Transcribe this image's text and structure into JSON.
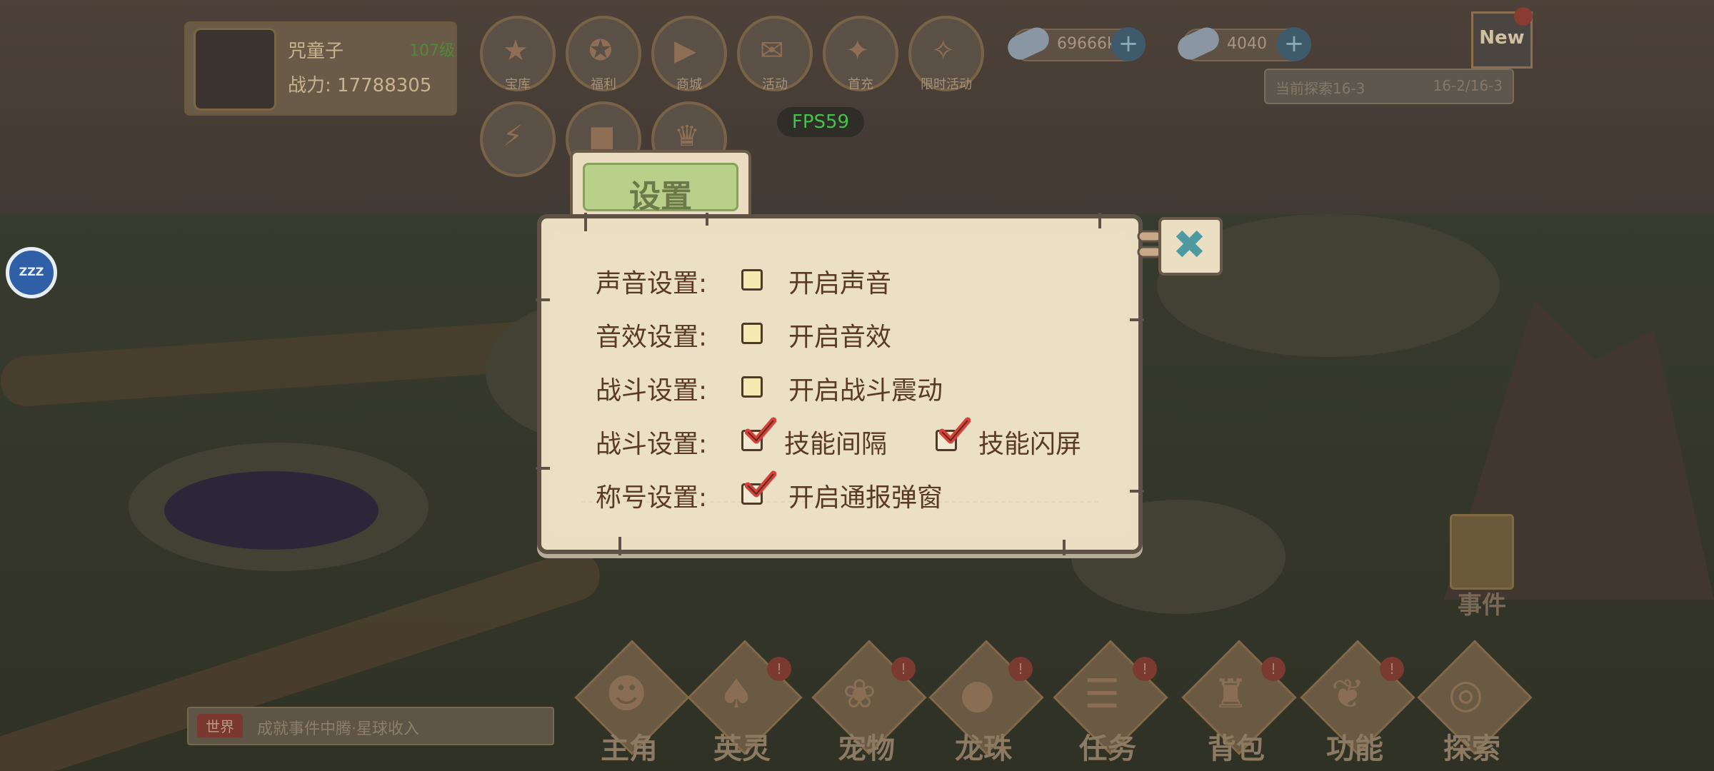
{
  "hud": {
    "player_name": "咒童子",
    "player_level": "107级",
    "player_power": "战力: 17788305",
    "top_buttons": [
      {
        "label": "宝库",
        "icon": "star-icon"
      },
      {
        "label": "福利",
        "icon": "medal-icon"
      },
      {
        "label": "商城",
        "icon": "shop-icon"
      },
      {
        "label": "活动",
        "icon": "gift-icon"
      },
      {
        "label": "首充",
        "icon": "fire-icon"
      },
      {
        "label": "限时活动",
        "icon": "hero-icon"
      }
    ],
    "resources": [
      {
        "value": "69666k",
        "icon": "pill-icon"
      },
      {
        "value": "4040",
        "icon": "pill-icon"
      }
    ],
    "new_badge": "New",
    "quest_title": "当前探索16-3",
    "quest_progress": "16-2/16-3",
    "fps": "FPS59",
    "sleep_label": "ZZZ"
  },
  "settings": {
    "title": "设置",
    "rows": [
      {
        "label": "声音设置:",
        "options": [
          {
            "text": "开启声音",
            "checked": false
          }
        ]
      },
      {
        "label": "音效设置:",
        "options": [
          {
            "text": "开启音效",
            "checked": false
          }
        ]
      },
      {
        "label": "战斗设置:",
        "options": [
          {
            "text": "开启战斗震动",
            "checked": false
          }
        ]
      },
      {
        "label": "战斗设置:",
        "options": [
          {
            "text": "技能间隔",
            "checked": true
          },
          {
            "text": "技能闪屏",
            "checked": true
          }
        ]
      },
      {
        "label": "称号设置:",
        "options": [
          {
            "text": "开启通报弹窗",
            "checked": true
          }
        ]
      }
    ]
  },
  "bottom": {
    "message_tag": "世界",
    "message_text": "成就事件中腾·星球收入",
    "nav": [
      {
        "label": "主角",
        "icon": "hero-icon"
      },
      {
        "label": "英灵",
        "icon": "spirit-icon"
      },
      {
        "label": "宠物",
        "icon": "pet-icon"
      },
      {
        "label": "龙珠",
        "icon": "orb-icon"
      },
      {
        "label": "任务",
        "icon": "scroll-icon"
      },
      {
        "label": "背包",
        "icon": "bag-icon"
      },
      {
        "label": "功能",
        "icon": "wing-icon"
      },
      {
        "label": "探索",
        "icon": "target-icon"
      }
    ],
    "event_label": "事件"
  },
  "colors": {
    "panel_bg": "#eadfc2",
    "panel_border": "#5e5246",
    "tab_green": "#b9d08a",
    "text_brown": "#5a3a22",
    "check_red": "#d8403a",
    "fps_green": "#46c24a",
    "close_teal": "#4f9aa0"
  }
}
